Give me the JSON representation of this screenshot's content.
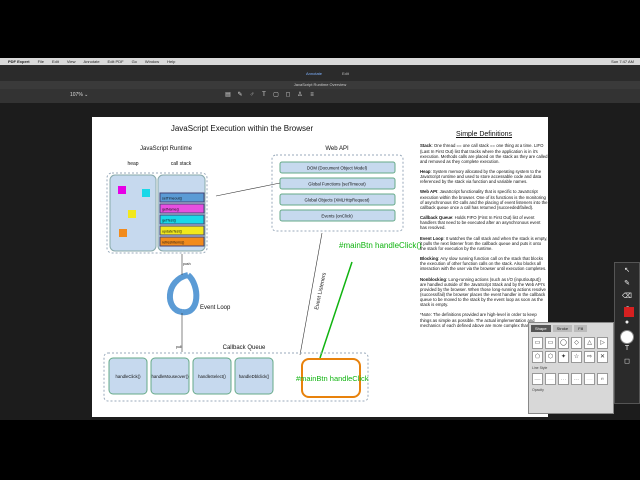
{
  "app": {
    "menu": [
      "PDF Expert",
      "File",
      "Edit",
      "View",
      "Annotate",
      "Edit PDF",
      "Go",
      "Window",
      "Help"
    ],
    "status_right": "Sun 7:47 AM",
    "tabs": [
      "Annotate",
      "Edit"
    ],
    "document_title": "JavaScript Runtime Overview",
    "zoom": "107% ⌄",
    "toolbar_icons": [
      "highlight-icon",
      "text-icon",
      "pen-icon",
      "text-box-icon",
      "note-icon",
      "shape-icon",
      "stamp-icon",
      "signature-icon"
    ],
    "toolbar_glyphs": [
      "▤",
      "✎",
      "♂",
      "T",
      "▢",
      "◻",
      "♙",
      "≡"
    ]
  },
  "diagram": {
    "title": "JavaScript Execution within the Browser",
    "runtime_title": "JavaScript Runtime",
    "heap_label": "heap",
    "stack_label": "call stack",
    "stack_items": [
      "setTimeout()",
      "getName()",
      "getTest()",
      "updateTest()",
      "refreshItems()"
    ],
    "web_api_title": "Web API",
    "web_api_items": [
      "DOM (Document Object Model)",
      "Global Functions (setTimeout)",
      "Global Objects (XMLHttpRequest)",
      "Events (onClick)"
    ],
    "event_listeners_label": "Event Listeners",
    "annotation_top": "#mainBtn handleClick()",
    "annotation_bottom": "#mainBtn handleClick",
    "event_loop_label": "Event Loop",
    "push_label": "push",
    "pull_label": "pull",
    "callback_queue_title": "Callback Queue",
    "callback_items": [
      "handleClick()",
      "handleMouseover()",
      "handleSelect()",
      "handleDblclick()"
    ]
  },
  "notes": {
    "title": "Simple Definitions",
    "paragraphs": [
      {
        "term": "Stack",
        "text": ": One thread == one call stack == one thing at a time. LIFO (Last In First Out) list that tracks where the application is in it's execution. Methods calls are placed on the stack as they are called and removed as they complete execution."
      },
      {
        "term": "Heap",
        "text": ": System memory allocated by the operating system to the JavaScript runtime and used to store accessable code and data referenced by the stack via function and variable names."
      },
      {
        "term": "Web API",
        "text": ": JavaScript functionality that is specific to JavaScript execution within the browser. One of its functions is the monitoring of asynchronous I/O calls and the placing of event listeners into the callback queue once a call has returned (succeeded/failed)."
      },
      {
        "term": "Callback Queue",
        "text": ": Holds FIFO (First In First Out) list of event handlers that need to be executed after an asynchronous event has resolved."
      },
      {
        "term": "Event Loop",
        "text": ": It watches the call stack and when the stack is empty, it pulls the next listener from the callback queue and puts it onto the stack for execution by the runtime."
      },
      {
        "term": "Blocking",
        "text": ": Any slow running function call on the stack that blocks the execution of other function calls on the stack. Also blocks all interaction with the user via the browser until execution completes."
      },
      {
        "term": "Nonblocking",
        "text": ": Long-running actions (such as I/O (input/output)) are handled outside of the JavaScript Stack and by the Web API's provided by the browser. When those long-running actions resolve (success/fail) the browser places the event handler in the callback queue to be moved to the stack by the event loop as soon as the stack is empty."
      },
      {
        "term": "",
        "text": "*Note: The definitions provided are high-level in order to keep things as simple as possible. The actual implementation and mechanics of each defined above are more complex than depicted."
      }
    ]
  },
  "shape_panel": {
    "tabs": [
      "Shape",
      "Stroke",
      "Fill"
    ],
    "line_style_label": "Line Style",
    "opacity_label": "Opacity",
    "shapes": [
      "▭",
      "▭",
      "◯",
      "◇",
      "△",
      "▷",
      "⬠",
      "⬡",
      "✦",
      "☆",
      "⇨",
      "✕"
    ],
    "line_styles": [
      "——",
      "······",
      "- - -",
      "-·-·-",
      "······",
      "⧠"
    ]
  },
  "palette": {
    "glyphs": [
      "↖",
      "✎",
      "⌫",
      "↶",
      "●",
      "⤢",
      "T",
      "◻"
    ]
  },
  "colors": {
    "heap_fill": "#c6d9ee",
    "stack_items_fill": [
      "#5b9bd5",
      "#e64fe0",
      "#19d8e8",
      "#f2e81c",
      "#f28b1c"
    ],
    "heap_blocks": [
      "#e600e6",
      "#19d8e8",
      "#f2e81c",
      "#f28b1c"
    ],
    "annotation_green": "#10b410",
    "highlight_orange": "#e8820c"
  }
}
